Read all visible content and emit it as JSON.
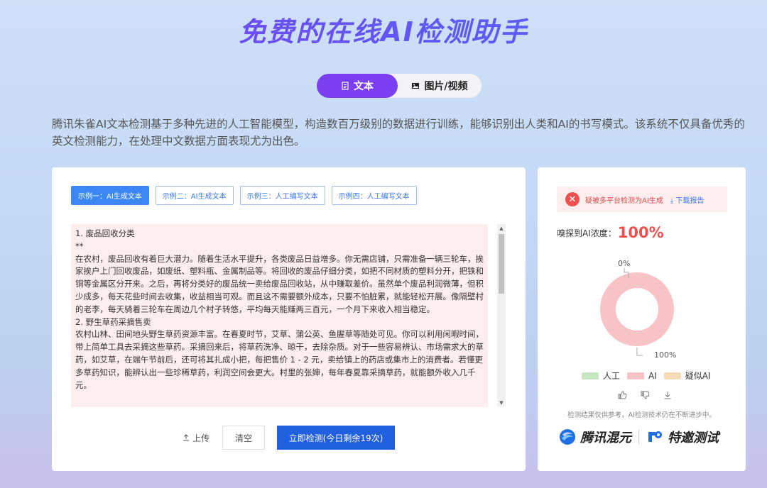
{
  "page_title": "免费的在线AI检测助手",
  "tabs": [
    {
      "label": "文本",
      "icon": "document-icon",
      "active": true
    },
    {
      "label": "图片/视频",
      "icon": "image-icon",
      "active": false
    }
  ],
  "description": "腾讯朱雀AI文本检测基于多种先进的人工智能模型，构造数百万级别的数据进行训练，能够识别出人类和AI的书写模式。该系统不仅具备优秀的英文检测能力，在处理中文数据方面表现尤为出色。",
  "examples": [
    {
      "label": "示例一：AI生成文本",
      "active": true
    },
    {
      "label": "示例二：AI生成文本",
      "active": false
    },
    {
      "label": "示例三：人工编写文本",
      "active": false
    },
    {
      "label": "示例四：人工编写文本",
      "active": false
    }
  ],
  "input_text": [
    "1. 废品回收分类",
    "**",
    "在农村，废品回收有着巨大潜力。随着生活水平提升，各类废品日益增多。你无需店铺，只需准备一辆三轮车，挨家挨户上门回收废品，如废纸、塑料瓶、金属制品等。将回收的废品仔细分类，如把不同材质的塑料分开，把铁和铜等金属区分开来。之后，再将分类好的废品统一卖给废品回收站，从中赚取差价。虽然单个废品利润微薄，但积少成多，每天花些时间去收集，收益相当可观。而且这不需要额外成本，只要不怕脏累，就能轻松开展。像隔壁村的老李，每天骑着三轮车在周边几个村子转悠，平均每天能赚两三百元，一个月下来收入相当稳定。",
    "2. 野生草药采摘售卖",
    "农村山林、田间地头野生草药资源丰富。在春夏时节，艾草、蒲公英、鱼腥草等随处可见。你可以利用闲暇时间，带上简单工具去采摘这些草药。采摘回来后，将草药洗净、晾干，去除杂质。对于一些容易辨认、市场需求大的草药，如艾草，在端午节前后，还可将其扎成小把，每把售价 1 - 2 元，卖给镇上的药店或集市上的消费者。若懂更多草药知识，能辨认出一些珍稀草药，利润空间会更大。村里的张婶，每年春夏靠采摘草药，就能额外收入几千元。"
  ],
  "actions": {
    "upload": "上传",
    "clear": "清空",
    "detect": "立即检测(今日剩余19次)"
  },
  "result": {
    "alert": "疑被多平台检测为AI生成",
    "download": "下载报告",
    "level_label": "嗅探到AI浓度：",
    "level_value": "100%",
    "pct_top": "0%",
    "pct_bottom": "100%",
    "legend": [
      {
        "label": "人工",
        "color": "#c8e6c0"
      },
      {
        "label": "AI",
        "color": "#f7c3c6"
      },
      {
        "label": "疑似AI",
        "color": "#f5dcb5"
      }
    ],
    "disclaimer": "检测结果仅供参考，AI检测技术仍在不断进步中。",
    "brand_left": "腾讯混元",
    "brand_right": "特邀测试"
  },
  "chart_data": {
    "type": "pie",
    "categories": [
      "人工",
      "AI",
      "疑似AI"
    ],
    "values": [
      0,
      100,
      0
    ]
  }
}
